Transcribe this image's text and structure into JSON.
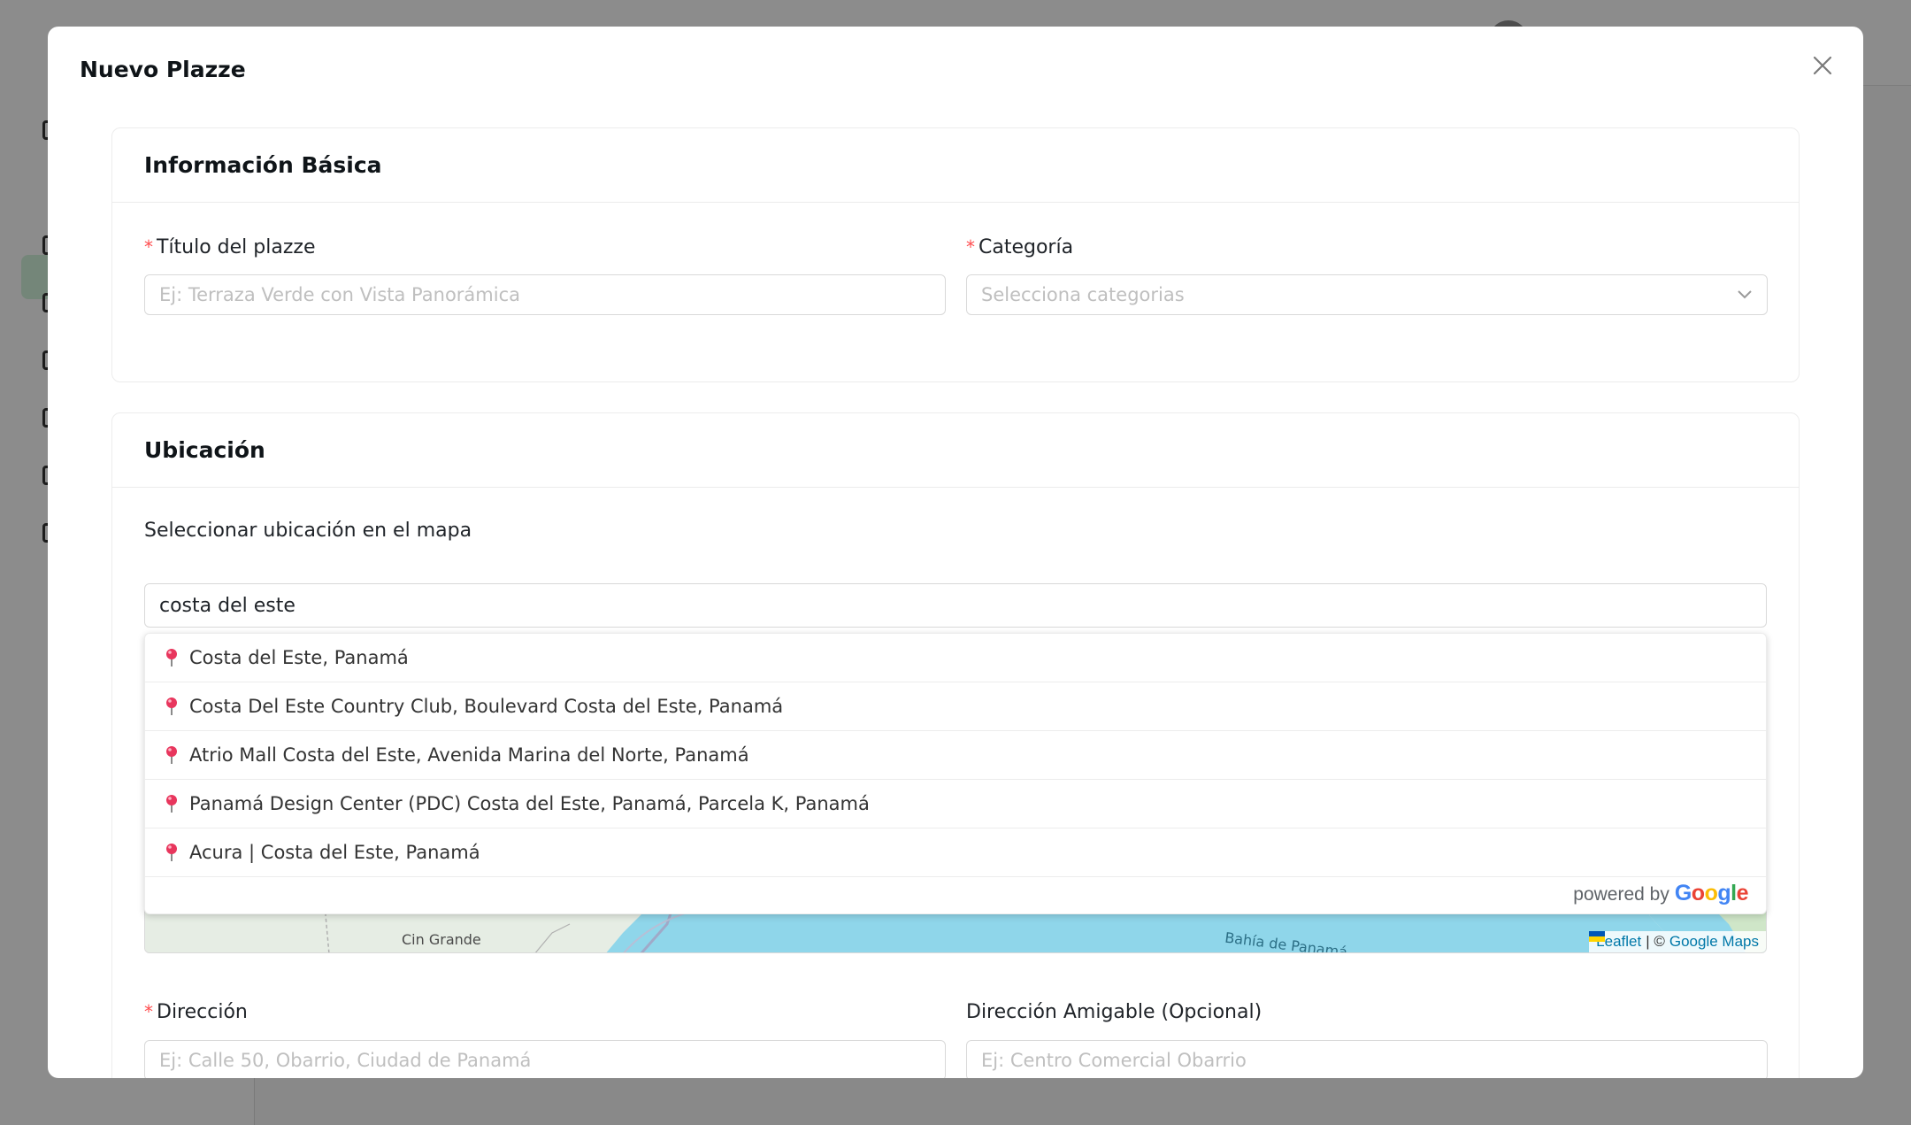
{
  "modal": {
    "title": "Nuevo Plazze"
  },
  "basic_info": {
    "title": "Información Básica",
    "title_field": {
      "label": "Título del plazze",
      "placeholder": "Ej: Terraza Verde con Vista Panorámica"
    },
    "category_field": {
      "label": "Categoría",
      "placeholder": "Selecciona categorias"
    }
  },
  "location": {
    "title": "Ubicación",
    "map_select_label": "Seleccionar ubicación en el mapa",
    "search_value": "costa del este",
    "suggestions": [
      {
        "text": "Costa del Este, Panamá"
      },
      {
        "text": "Costa Del Este Country Club, Boulevard Costa del Este, Panamá"
      },
      {
        "text": "Atrio Mall Costa del Este, Avenida Marina del Norte, Panamá"
      },
      {
        "text": "Panamá Design Center (PDC) Costa del Este, Panamá, Parcela K, Panamá"
      },
      {
        "text": "Acura | Costa del Este, Panamá"
      }
    ],
    "powered_by": "powered by",
    "google_letters": [
      {
        "ch": "G",
        "color": "#4285F4"
      },
      {
        "ch": "o",
        "color": "#EA4335"
      },
      {
        "ch": "o",
        "color": "#FBBC05"
      },
      {
        "ch": "g",
        "color": "#4285F4"
      },
      {
        "ch": "l",
        "color": "#34A853"
      },
      {
        "ch": "e",
        "color": "#EA4335"
      }
    ],
    "map": {
      "label_cerro": "Cin Grande",
      "label_bay": "Bahía de Panamá",
      "attribution_leaflet": "Leaflet",
      "attribution_sep": "| ©",
      "attribution_google": "Google Maps"
    },
    "address_field": {
      "label": "Dirección",
      "placeholder": "Ej: Calle 50, Obarrio, Ciudad de Panamá"
    },
    "friendly_address_field": {
      "label": "Dirección Amigable (Opcional)",
      "placeholder": "Ej: Centro Comercial Obarrio"
    }
  },
  "colors": {
    "required": "#ff4d4f",
    "pin": "#e8365d",
    "water": "#8fd6ea",
    "link": "#0078a8"
  }
}
